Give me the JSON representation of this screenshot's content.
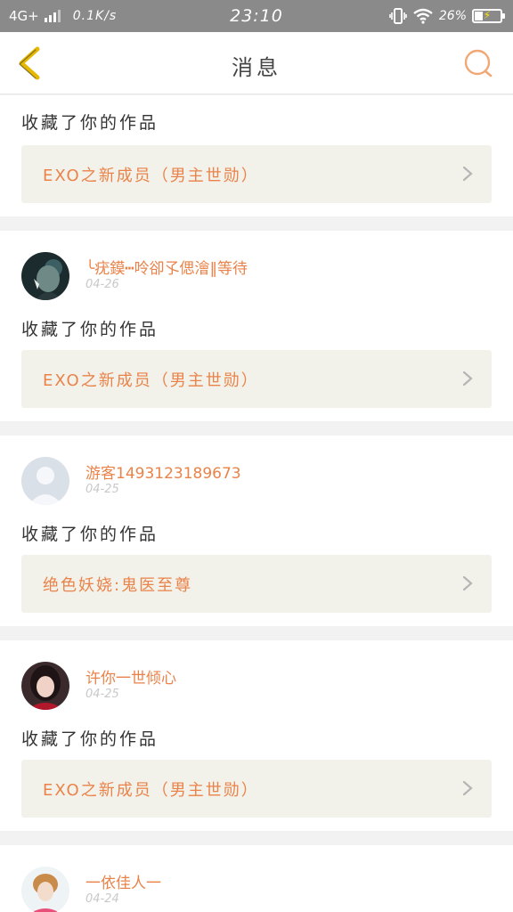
{
  "status_bar": {
    "network": "4G+",
    "speed": "0.1K/s",
    "time": "23:10",
    "battery": "26%"
  },
  "header": {
    "title": "消息",
    "back_icon": "chevron-left-icon",
    "search_icon": "search-icon"
  },
  "colors": {
    "accent": "#e9834a",
    "back_arrow": "#e6b800",
    "work_bg": "#f3f2ea"
  },
  "messages": [
    {
      "user": "",
      "date": "",
      "action": "收藏了你的作品",
      "work_title": "EXO之新成员（男主世勋）"
    },
    {
      "user": "╰疣鏌┅呤卻孓偲澮‖等待",
      "date": "04-26",
      "action": "收藏了你的作品",
      "work_title": "EXO之新成员（男主世勋）"
    },
    {
      "user": "游客1493123189673",
      "date": "04-25",
      "action": "收藏了你的作品",
      "work_title": "绝色妖娆:鬼医至尊"
    },
    {
      "user": "许你一世倾心",
      "date": "04-25",
      "action": "收藏了你的作品",
      "work_title": "EXO之新成员（男主世勋）"
    },
    {
      "user": "一依佳人一",
      "date": "04-24",
      "action": "",
      "work_title": ""
    }
  ]
}
